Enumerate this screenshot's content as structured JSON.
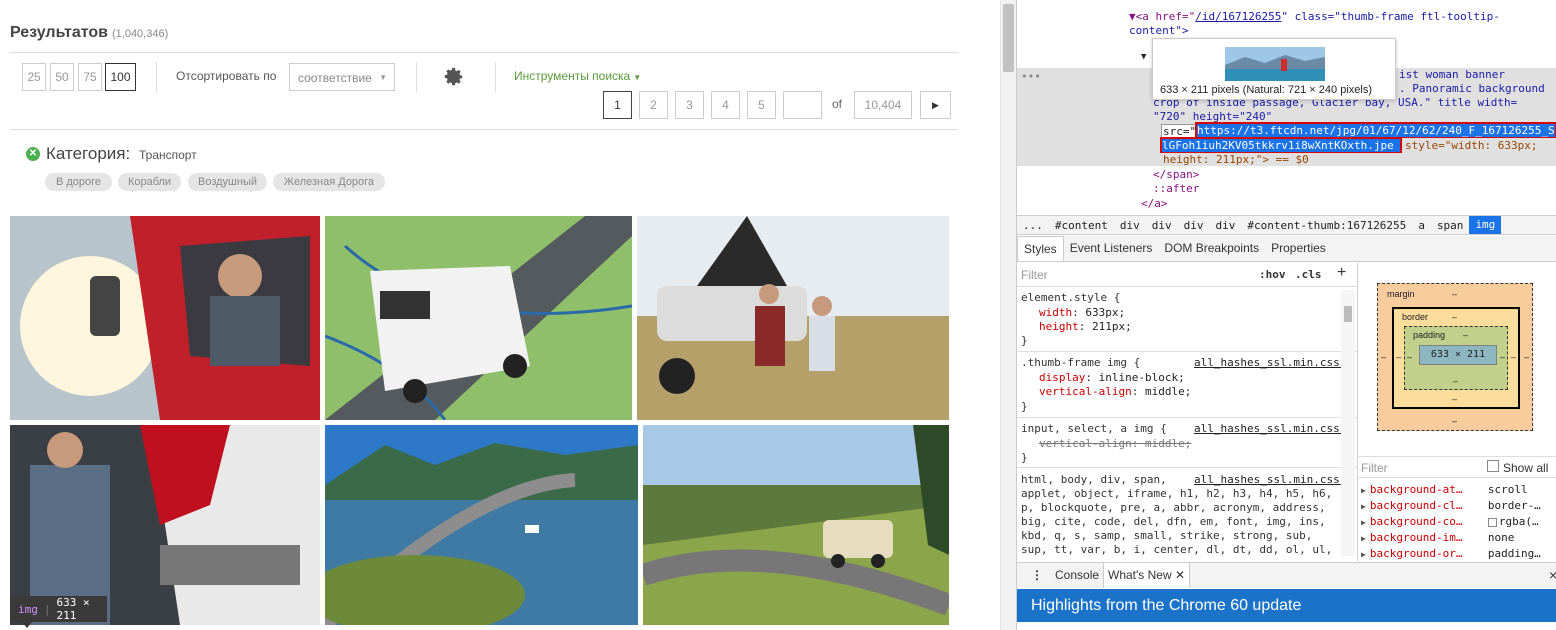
{
  "results": {
    "title": "Результатов",
    "count": "(1,040,346)"
  },
  "per_page": [
    {
      "label": "25",
      "active": false
    },
    {
      "label": "50",
      "active": false
    },
    {
      "label": "75",
      "active": false
    },
    {
      "label": "100",
      "active": true
    }
  ],
  "sort": {
    "label": "Отсортировать по",
    "value": "соответствие"
  },
  "tools_label": "Инструменты поиска",
  "pagination": {
    "pages": [
      "1",
      "2",
      "3",
      "4",
      "5"
    ],
    "current": "1",
    "input_value": "",
    "of_label": "of",
    "total": "10,404",
    "next_icon": "chevron-right-icon"
  },
  "category": {
    "label": "Категория:",
    "value": "Транспорт",
    "chips": [
      "В дороге",
      "Корабли",
      "Воздушный",
      "Железная Дорога"
    ]
  },
  "thumbnails": [
    {
      "name": "truck-driver-thumb"
    },
    {
      "name": "van-on-road-thumb"
    },
    {
      "name": "broken-car-couple-thumb"
    },
    {
      "name": "truck-washing-thumb"
    },
    {
      "name": "atlantic-road-bridge-thumb"
    },
    {
      "name": "rv-road-thumb"
    }
  ],
  "element_tooltip": {
    "tag": "img",
    "size": "633 × 211"
  },
  "devtools": {
    "dom": {
      "line_a_open": "▼<a href=\"",
      "line_a_href": "/id/167126255",
      "line_a_mid": "\" class=\"thumb-frame ftl-tooltip-",
      "line_a_cont": "content\">",
      "line_span": "▼",
      "line_alt1": "ist woman banner",
      "line_alt2": ". Panoramic background",
      "line_alt3": "crop of inside passage, Glacier bay, USA.\" title width=",
      "line_h": "\"720\" height=\"240\"",
      "src_attr": "src=\"",
      "src_url1": "https://t3.ftcdn.net/jpg/01/67/12/62/240_F_167126255_S",
      "src_url2": "lGFoh1iuh2KV05tkkrv1i8wXntKOxth.jpe",
      "src_style": "style=\"width: 633px;",
      "src_style2": "height: 211px;\"> == $0",
      "span_close": "</span>",
      "after": "::after",
      "a_close": "</a>",
      "ellipsis": "•••",
      "tip_text": "633 × 211 pixels (Natural: 721 × 240 pixels)"
    },
    "breadcrumb": [
      "...",
      "#content",
      "div",
      "div",
      "div",
      "div",
      "#content-thumb:167126255",
      "a",
      "span",
      "img"
    ],
    "tabs": [
      "Styles",
      "Event Listeners",
      "DOM Breakpoints",
      "Properties"
    ],
    "styles_filter": {
      "placeholder": "Filter",
      "hov": ":hov",
      "cls": ".cls",
      "plus": "+"
    },
    "rules": {
      "element_style": "element.style {",
      "es_width_p": "width",
      "es_width_v": "633px;",
      "es_height_p": "height",
      "es_height_v": "211px;",
      "close": "}",
      "thumb_sel": ".thumb-frame img {",
      "thumb_src": "all_hashes_ssl.min.css:1",
      "thumb_disp_p": "display",
      "thumb_disp_v": "inline-block;",
      "thumb_va_p": "vertical-align",
      "thumb_va_v": "middle;",
      "input_sel": "input, select, a img {",
      "input_src": "all_hashes_ssl.min.css:1",
      "input_va": "vertical-align: middle;",
      "html_sel": "html, body, div, span,",
      "html_src": "all_hashes_ssl.min.css:1",
      "html_l2": "applet, object, iframe, h1, h2, h3, h4, h5, h6,",
      "html_l3": "p, blockquote, pre, a, abbr, acronym, address,",
      "html_l4": "big, cite, code, del, dfn, em, font, img, ins,",
      "html_l5": "kbd, q, s, samp, small, strike, strong, sub,",
      "html_l6": "sup, tt, var, b, i, center, dl, dt, dd, ol, ul,"
    },
    "boxmodel": {
      "margin": "margin",
      "border": "border",
      "padding": "padding",
      "content": "633 × 211",
      "dash": "–"
    },
    "computed": {
      "filter": "Filter",
      "show_all": "Show all",
      "rows": [
        {
          "name": "background-at…",
          "value": "scroll"
        },
        {
          "name": "background-cl…",
          "value": "border-…"
        },
        {
          "name": "background-co…",
          "value": "rgba(…"
        },
        {
          "name": "background-im…",
          "value": "none"
        },
        {
          "name": "background-or…",
          "value": "padding…"
        }
      ]
    },
    "drawer": {
      "menu": "⋮",
      "tabs": [
        "Console",
        "What's New"
      ],
      "close": "×"
    },
    "banner": "Highlights from the Chrome 60 update"
  }
}
